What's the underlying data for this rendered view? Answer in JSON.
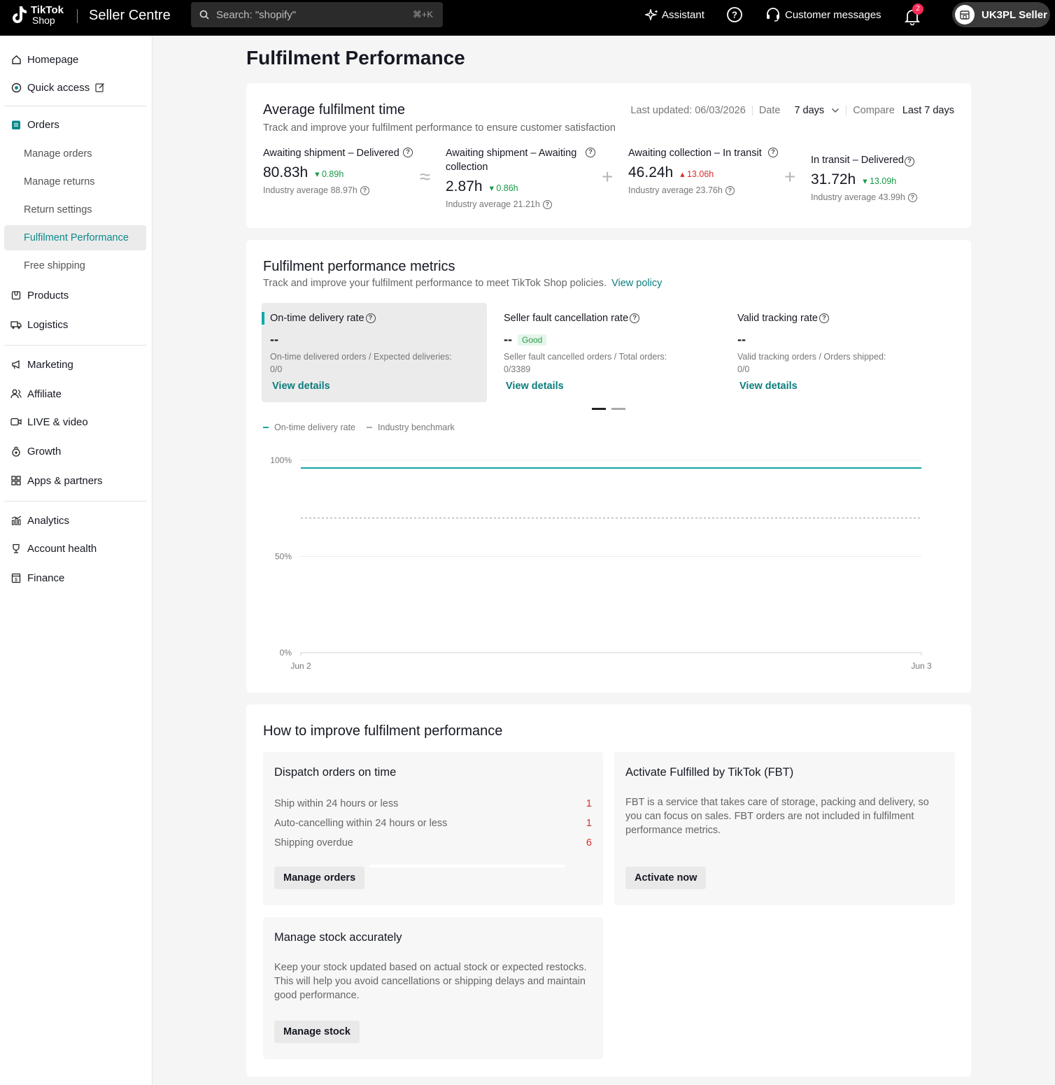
{
  "topbar": {
    "logo_line1": "TikTok",
    "logo_line2": "Shop",
    "brand": "Seller Centre",
    "search_placeholder": "Search: \"shopify\"",
    "search_shortcut": "⌘+K",
    "assistant": "Assistant",
    "customer_messages": "Customer messages",
    "notification_count": "2",
    "account_name": "UK3PL Seller"
  },
  "sidebar": {
    "homepage": "Homepage",
    "quick_access": "Quick access",
    "orders": "Orders",
    "manage_orders": "Manage orders",
    "manage_returns": "Manage returns",
    "return_settings": "Return settings",
    "fulfilment_performance": "Fulfilment Performance",
    "free_shipping": "Free shipping",
    "products": "Products",
    "logistics": "Logistics",
    "marketing": "Marketing",
    "affiliate": "Affiliate",
    "live_video": "LIVE & video",
    "growth": "Growth",
    "apps_partners": "Apps & partners",
    "analytics": "Analytics",
    "account_health": "Account health",
    "finance": "Finance"
  },
  "page": {
    "title": "Fulfilment Performance"
  },
  "avg_card": {
    "title": "Average fulfilment time",
    "desc": "Track and improve your fulfilment performance to ensure customer satisfaction",
    "last_updated": "Last updated: 06/03/2026",
    "date_label": "Date",
    "date_value": "7 days",
    "compare_label": "Compare",
    "compare_value": "Last 7 days",
    "op1": "≈",
    "op2": "+",
    "op3": "+",
    "metrics": [
      {
        "title": "Awaiting shipment – Delivered",
        "value": "80.83h",
        "delta": "0.89h",
        "dir": "down",
        "industry": "Industry average 88.97h"
      },
      {
        "title": "Awaiting shipment – Awaiting collection",
        "value": "2.87h",
        "delta": "0.86h",
        "dir": "down",
        "industry": "Industry average 21.21h"
      },
      {
        "title": "Awaiting collection – In transit",
        "value": "46.24h",
        "delta": "13.06h",
        "dir": "up",
        "industry": "Industry average 23.76h"
      },
      {
        "title": "In transit – Delivered",
        "value": "31.72h",
        "delta": "13.09h",
        "dir": "down",
        "industry": "Industry average 43.99h"
      }
    ]
  },
  "metrics_card": {
    "title": "Fulfilment performance metrics",
    "desc": "Track and improve your fulfilment performance to meet TikTok Shop policies.",
    "view_policy": "View policy",
    "items": [
      {
        "title": "On-time delivery rate",
        "value": "--",
        "formula": "On-time delivered orders / Expected deliveries:",
        "fraction": "0/0",
        "link": "View details"
      },
      {
        "title": "Seller fault cancellation rate",
        "value": "--",
        "badge": "Good",
        "formula": "Seller fault cancelled orders / Total orders:",
        "fraction": "0/3389",
        "link": "View details"
      },
      {
        "title": "Valid tracking rate",
        "value": "--",
        "formula": "Valid tracking orders / Orders shipped:",
        "fraction": "0/0",
        "link": "View details"
      }
    ]
  },
  "chart_data": {
    "type": "line",
    "x": [
      "Jun 2",
      "Jun 3"
    ],
    "series": [
      {
        "name": "On-time delivery rate",
        "color": "#13a3a3",
        "values": [
          96,
          96
        ]
      },
      {
        "name": "Industry benchmark",
        "color": "#b8b8b8",
        "dashed": true,
        "values": [
          70,
          70
        ]
      }
    ],
    "yticks": [
      "100%",
      "50%",
      "0%"
    ],
    "ylim": [
      0,
      100
    ],
    "grid": true,
    "legend": "top-left"
  },
  "improve_card": {
    "title": "How to improve fulfilment performance",
    "dispatch": {
      "title": "Dispatch orders on time",
      "rows": [
        {
          "label": "Ship within 24 hours or less",
          "count": "1"
        },
        {
          "label": "Auto-cancelling within 24 hours or less",
          "count": "1"
        },
        {
          "label": "Shipping overdue",
          "count": "6"
        }
      ],
      "button": "Manage orders"
    },
    "fbt": {
      "title": "Activate Fulfilled by TikTok (FBT)",
      "text": "FBT is a service that takes care of storage, packing and delivery, so you can focus on sales. FBT orders are not included in fulfilment performance metrics.",
      "button": "Activate now"
    },
    "stock": {
      "title": "Manage stock accurately",
      "text": "Keep your stock updated based on actual stock or expected restocks. This will help you avoid cancellations or shipping delays and maintain good performance.",
      "button": "Manage stock"
    }
  }
}
